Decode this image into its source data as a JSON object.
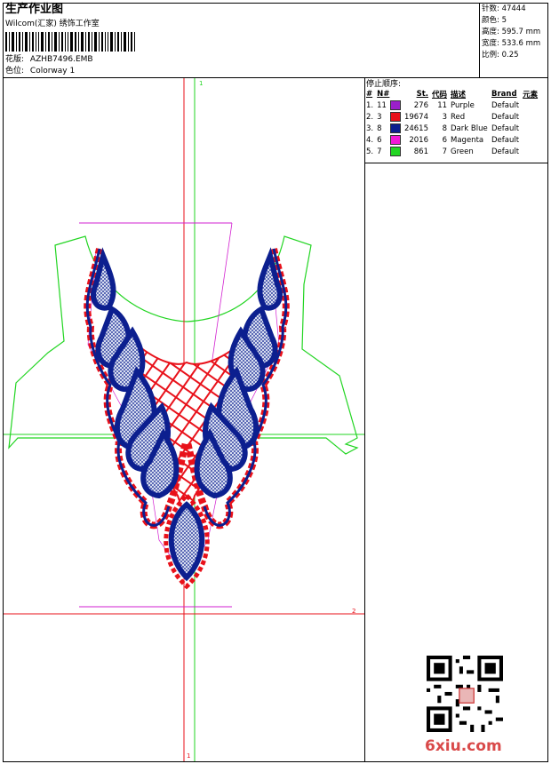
{
  "header": {
    "title": "生产作业图",
    "studio": "Wilcom(汇家) 绣饰工作室",
    "design_label": "花版:",
    "design_value": "AZHB7496.EMB",
    "colorway_label": "色位:",
    "colorway_value": "Colorway 1"
  },
  "specs": [
    {
      "label": "针数:",
      "value": "47444"
    },
    {
      "label": "颜色:",
      "value": "5"
    },
    {
      "label": "高度:",
      "value": "595.7 mm"
    },
    {
      "label": "宽度:",
      "value": "533.6 mm"
    },
    {
      "label": "比例:",
      "value": "0.25"
    }
  ],
  "stop_sequence": {
    "title": "停止顺序:",
    "columns": [
      "#",
      "N#",
      "St.",
      "代码",
      "描述",
      "Brand",
      "元素"
    ],
    "rows": [
      {
        "idx": "1.",
        "n": "11",
        "color": "#9b1fc9",
        "st": "276",
        "code": "11",
        "desc": "Purple",
        "brand": "Default"
      },
      {
        "idx": "2.",
        "n": "3",
        "color": "#e8111a",
        "st": "19674",
        "code": "3",
        "desc": "Red",
        "brand": "Default"
      },
      {
        "idx": "3.",
        "n": "8",
        "color": "#0c1f8f",
        "st": "24615",
        "code": "8",
        "desc": "Dark Blue",
        "brand": "Default"
      },
      {
        "idx": "4.",
        "n": "6",
        "color": "#f01ad6",
        "st": "2016",
        "code": "6",
        "desc": "Magenta",
        "brand": "Default"
      },
      {
        "idx": "5.",
        "n": "7",
        "color": "#22d522",
        "st": "861",
        "code": "7",
        "desc": "Green",
        "brand": "Default"
      }
    ]
  },
  "canvas": {
    "marker_top": "1",
    "marker_right": "2",
    "marker_bottom": "1"
  },
  "watermark": "6xiu.com",
  "colors": {
    "red": "#e8111a",
    "blue": "#0c1f8f",
    "green": "#22d522",
    "magenta": "#d21fd0"
  }
}
